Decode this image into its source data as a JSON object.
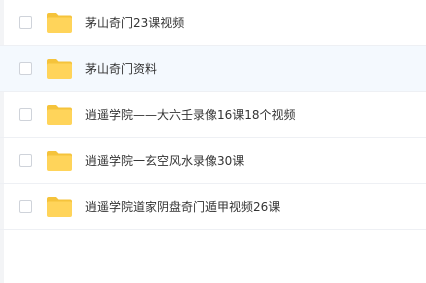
{
  "file_list": {
    "items": [
      {
        "name": "茅山奇门23课视频",
        "icon": "folder-icon"
      },
      {
        "name": "茅山奇门资料",
        "icon": "folder-icon"
      },
      {
        "name": "逍遥学院——大六壬录像16课18个视频",
        "icon": "folder-icon"
      },
      {
        "name": "逍遥学院一玄空风水录像30课",
        "icon": "folder-icon"
      },
      {
        "name": "逍遥学院道家阴盘奇门遁甲视频26课",
        "icon": "folder-icon"
      }
    ]
  },
  "colors": {
    "folder": "#ffd45a",
    "folder_tab": "#f5c33b",
    "hover_row": "#f4f9fe",
    "text": "#333333"
  }
}
